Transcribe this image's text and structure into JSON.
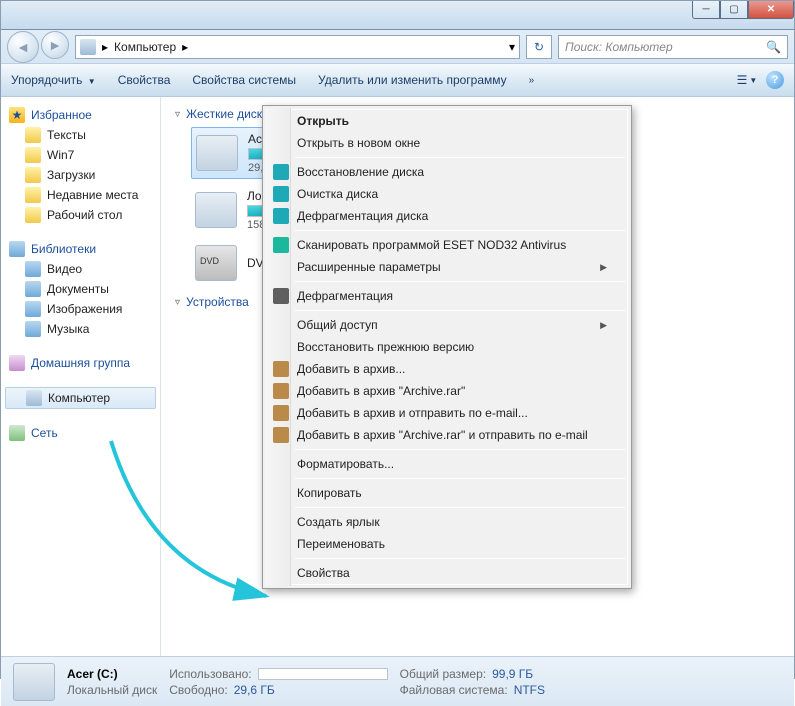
{
  "titlebar": {
    "title": ""
  },
  "address": {
    "crumb_root": "Компьютер",
    "search_placeholder": "Поиск: Компьютер"
  },
  "toolbar": {
    "organize": "Упорядочить",
    "properties": "Свойства",
    "sysprops": "Свойства системы",
    "uninstall": "Удалить или изменить программу",
    "chevron": "»"
  },
  "sidebar": {
    "favorites": "Избранное",
    "fav_items": [
      "Тексты",
      "Win7",
      "Загрузки",
      "Недавние места",
      "Рабочий стол"
    ],
    "libraries": "Библиотеки",
    "lib_items": [
      "Видео",
      "Документы",
      "Изображения",
      "Музыка"
    ],
    "homegroup": "Домашняя группа",
    "computer": "Компьютер",
    "network": "Сеть"
  },
  "content": {
    "hdd_header": "Жесткие диски (3)",
    "dev_header": "Устройства",
    "drives": [
      {
        "name": "Ace",
        "free": "29,6",
        "bar": 70,
        "selected": true
      },
      {
        "name": "Лок",
        "free": "158",
        "bar": 45
      },
      {
        "name": "DVD",
        "free": "",
        "dvd": true
      }
    ]
  },
  "context_menu": [
    {
      "label": "Открыть",
      "bold": true
    },
    {
      "label": "Открыть в новом окне"
    },
    {
      "sep": true
    },
    {
      "label": "Восстановление диска",
      "icon": "#1fa8b5"
    },
    {
      "label": "Очистка диска",
      "icon": "#1fa8b5"
    },
    {
      "label": "Дефрагментация диска",
      "icon": "#1fa8b5"
    },
    {
      "sep": true
    },
    {
      "label": "Сканировать программой ESET NOD32 Antivirus",
      "icon": "#1bb89c"
    },
    {
      "label": "Расширенные параметры",
      "sub": true
    },
    {
      "sep": true
    },
    {
      "label": "Дефрагментация",
      "icon": "#5f5f5f"
    },
    {
      "sep": true
    },
    {
      "label": "Общий доступ",
      "sub": true
    },
    {
      "label": "Восстановить прежнюю версию"
    },
    {
      "label": "Добавить в архив...",
      "icon": "#b98a4a"
    },
    {
      "label": "Добавить в архив \"Archive.rar\"",
      "icon": "#b98a4a"
    },
    {
      "label": "Добавить в архив и отправить по e-mail...",
      "icon": "#b98a4a"
    },
    {
      "label": "Добавить в архив \"Archive.rar\" и отправить по e-mail",
      "icon": "#b98a4a"
    },
    {
      "sep": true
    },
    {
      "label": "Форматировать..."
    },
    {
      "sep": true
    },
    {
      "label": "Копировать"
    },
    {
      "sep": true
    },
    {
      "label": "Создать ярлык"
    },
    {
      "label": "Переименовать"
    },
    {
      "sep": true
    },
    {
      "label": "Свойства"
    }
  ],
  "status": {
    "name": "Acer (C:)",
    "type": "Локальный диск",
    "used_lbl": "Использовано:",
    "free_lbl": "Свободно:",
    "free_val": "29,6 ГБ",
    "size_lbl": "Общий размер:",
    "size_val": "99,9 ГБ",
    "fs_lbl": "Файловая система:",
    "fs_val": "NTFS"
  }
}
